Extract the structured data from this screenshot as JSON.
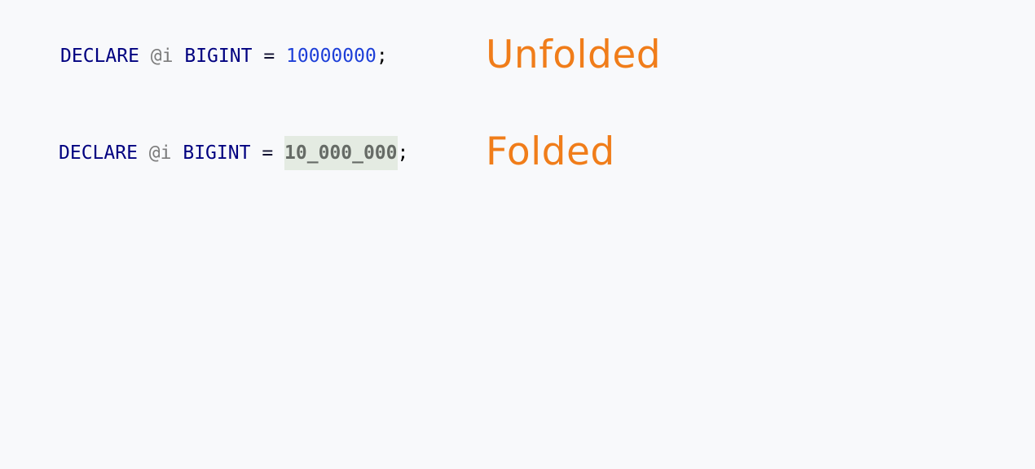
{
  "unfolded": {
    "keyword_declare": "DECLARE",
    "variable": "@i",
    "type": "BIGINT",
    "operator": "=",
    "value": "10000000",
    "terminator": ";",
    "label": "Unfolded"
  },
  "folded": {
    "keyword_declare": "DECLARE",
    "variable": "@i",
    "type": "BIGINT",
    "operator": "=",
    "value": "10_000_000",
    "terminator": ";",
    "label": "Folded"
  },
  "colors": {
    "keyword": "#000080",
    "variable": "#7c7c7c",
    "number": "#1d3fd8",
    "folded_background": "#e4ebe2",
    "label": "#f07d1a"
  }
}
